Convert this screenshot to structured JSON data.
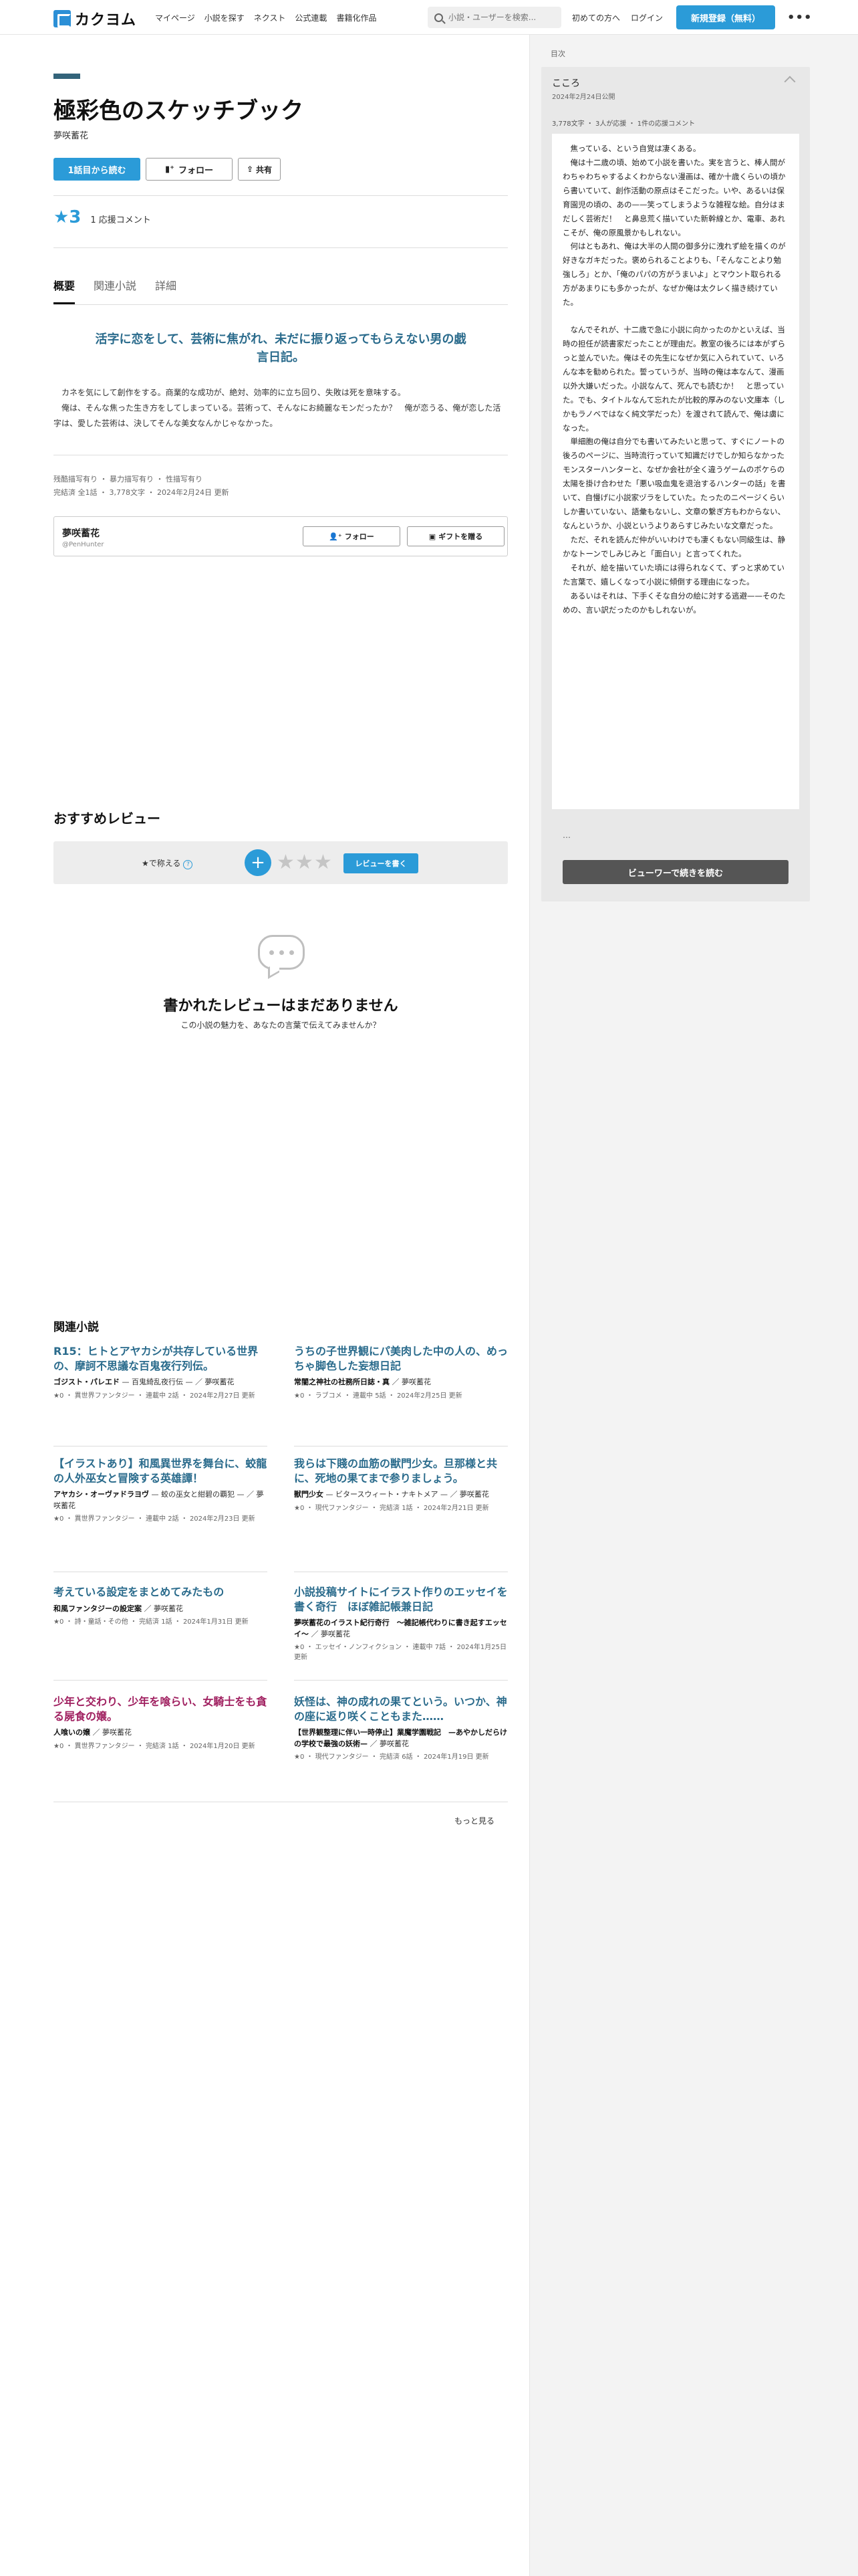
{
  "header": {
    "logo_text": "カクヨム",
    "nav": [
      "マイページ",
      "小説を探す",
      "ネクスト",
      "公式連載",
      "書籍化作品"
    ],
    "search_placeholder": "小説・ユーザーを検索...",
    "beginners": "初めての方へ",
    "login": "ログイン",
    "signup": "新規登録（無料）"
  },
  "work": {
    "title": "極彩色のスケッチブック",
    "author": "夢咲蓄花",
    "read_button": "1話目から読む",
    "follow_button": "フォロー",
    "share_button": "共有",
    "stars": "★3",
    "support_comments": "1 応援コメント"
  },
  "tabs": [
    "概要",
    "関連小説",
    "詳細"
  ],
  "catchphrase": "活字に恋をして、芸術に焦がれ、未だに振り返ってもらえない男の戯言日記。",
  "intro": [
    "カネを気にして創作をする。商業的な成功が、絶対、効率的に立ち回り、失敗は死を意味する。",
    "俺は、そんな焦った生き方をしてしまっている。芸術って、そんなにお綺麗なモンだったか？　俺が恋うる、俺が恋した活字は、愛した芸術は、決してそんな美女なんかじゃなかった。"
  ],
  "tags": "残酷描写有り ・ 暴力描写有り ・ 性描写有り",
  "meta": "完結済 全1話 ・ 3,778文字 ・ 2024年2月24日 更新",
  "author_card": {
    "name": "夢咲蓄花",
    "id": "@PenHunter",
    "follow": "フォロー",
    "gift": "ギフトを贈る"
  },
  "reviews": {
    "section_title": "おすすめレビュー",
    "label": "★で称える",
    "help": "?",
    "plus": "+",
    "write_button": "レビューを書く",
    "empty_title": "書かれたレビューはまだありません",
    "empty_sub": "この小説の魅力を、あなたの言葉で伝えてみませんか？"
  },
  "related": {
    "section_title": "関連小説",
    "items": [
      {
        "title": "R15：ヒトとアヤカシが共存している世界の、摩訶不思議な百鬼夜行列伝。",
        "sub": "ゴジスト・パレエド",
        "sub2": "— 百鬼綺乱夜行伝 — ／ 夢咲蓄花",
        "meta": "★0 ・ 異世界ファンタジー ・ 連載中 2話 ・ 2024年2月27日 更新",
        "pink": false
      },
      {
        "title": "うちの子世界観にパ美肉した中の人の、めっちゃ脚色した妄想日記",
        "sub": "常闇之神社の社務所日誌・真",
        "sub2": "／ 夢咲蓄花",
        "meta": "★0 ・ ラブコメ ・ 連載中 5話 ・ 2024年2月25日 更新",
        "pink": false
      },
      {
        "title": "【イラストあり】和風異世界を舞台に、蛟龍の人外巫女と冒険する英雄譚！",
        "sub": "アヤカシ・オーヴァドラヨヴ",
        "sub2": "— 蛟の巫女と紺碧の覇犯 — ／ 夢咲蓄花",
        "meta": "★0 ・ 異世界ファンタジー ・ 連載中 2話 ・ 2024年2月23日 更新",
        "pink": false
      },
      {
        "title": "我らは下賤の血筋の獣門少女。旦那様と共に、死地の果てまで参りましょう。",
        "sub": "獣門少女",
        "sub2": "— ビタースウィート・ナキトメア — ／ 夢咲蓄花",
        "meta": "★0 ・ 現代ファンタジー ・ 完結済 1話 ・ 2024年2月21日 更新",
        "pink": false
      },
      {
        "title": "考えている設定をまとめてみたもの",
        "sub": "和風ファンタジーの設定案",
        "sub2": "／ 夢咲蓄花",
        "meta": "★0 ・ 詩・童話・その他 ・ 完結済 1話 ・ 2024年1月31日 更新",
        "pink": false
      },
      {
        "title": "小説投稿サイトにイラスト作りのエッセイを書く奇行　ほぼ雑記帳兼日記",
        "sub": "夢咲蓄花のイラスト紀行奇行　〜雑記帳代わりに書き起すエッセイ〜",
        "sub2": "／ 夢咲蓄花",
        "meta": "★0 ・ エッセイ・ノンフィクション ・ 連載中 7話 ・ 2024年1月25日 更新",
        "pink": false
      },
      {
        "title": "少年と交わり、少年を喰らい、女騎士をも貪る屍食の嬢。",
        "sub": "人喰いの嬢",
        "sub2": "／ 夢咲蓄花",
        "meta": "★0 ・ 異世界ファンタジー ・ 完結済 1話 ・ 2024年1月20日 更新",
        "pink": true
      },
      {
        "title": "妖怪は、神の成れの果てという。いつか、神の座に返り咲くこともまた……",
        "sub": "【世界観整理に伴い一時停止】業魔学園戦記　—あやかしだらけの学校で最強の妖術—",
        "sub2": "／ 夢咲蓄花",
        "meta": "★0 ・ 現代ファンタジー ・ 完結済 6話 ・ 2024年1月19日 更新",
        "pink": false
      }
    ],
    "more": "もっと見る"
  },
  "sidebar": {
    "toc_label": "目次",
    "episode_title": "こころ",
    "episode_date": "2024年2月24日公開",
    "stats": "3,778文字 ・ 3人が応援 ・ 1件の応援コメント",
    "body": [
      "焦っている、という自覚は凄くある。",
      "俺は十二歳の頃、始めて小説を書いた。実を言うと、棒人間がわちゃわちゃするよくわからない漫画は、確か十歳くらいの頃から書いていて、創作活動の原点はそこだった。いや、あるいは保育園児の頃の、あの——笑ってしまうような雑程な絵。自分はまだしく芸術だ！　と鼻息荒く描いていた新幹線とか、電車、あれこそが、俺の原風景かもしれない。",
      "何はともあれ、俺は大半の人間の御多分に洩れず絵を描くのが好きなガキだった。褒められることよりも、「そんなことより勉強しろ」とか、「俺のパパの方がうまいよ」とマウント取られる方があまりにも多かったが、なぜか俺は太クレく描き続けていた。",
      "なんでそれが、十二歳で急に小説に向かったのかといえば、当時の担任が読書家だったことが理由だ。教室の後ろには本がずらっと並んでいた。俺はその先生になぜか気に入られていて、いろんな本を勧められた。誓っていうが、当時の俺は本なんて、漫画以外大嫌いだった。小説なんて、死んでも読むか！　と思っていた。でも、タイトルなんて忘れたが比較的厚みのない文庫本（しかもラノベではなく純文学だった）を渡されて読んで、俺は虜になった。",
      "単細胞の俺は自分でも書いてみたいと思って、すぐにノートの後ろのページに、当時流行っていて知識だけでしか知らなかったモンスターハンターと、なぜか会社が全く違うゲームのポケらの太陽を掛け合わせた「悪い吸血鬼を退治するハンターの話」を書いて、自慢げに小説家ヅラをしていた。たったのニページくらいしか書いていない、語彙もないし、文章の繋ぎ方もわからない、なんというか、小説というよりあらすじみたいな文章だった。",
      "ただ、それを読んだ仲がいいわけでも凄くもない同級生は、静かなトーンでしみじみと「面白い」と言ってくれた。",
      "それが、絵を描いていた頃には得られなくて、ずっと求めていた言葉で、嬉しくなって小説に傾倒する理由になった。",
      "あるいはそれは、下手くそな自分の絵に対する逃避——そのための、言い訳だったのかもしれないが。"
    ],
    "ellipsis": "…",
    "viewer_button": "ビューワーで続きを読む"
  }
}
